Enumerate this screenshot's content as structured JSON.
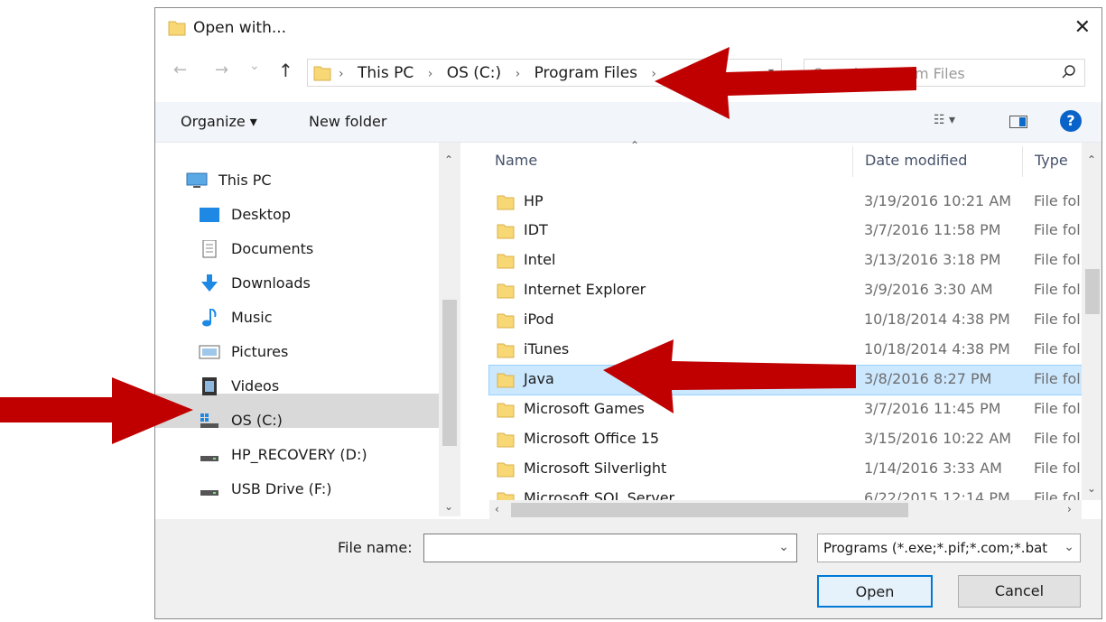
{
  "window": {
    "title": "Open with..."
  },
  "nav": {
    "back": "←",
    "forward": "→",
    "recent": "⌄",
    "up": "↑"
  },
  "address": {
    "crumbs": [
      "This PC",
      "OS (C:)",
      "Program Files"
    ],
    "separator": "›"
  },
  "search": {
    "placeholder": "Search Program Files"
  },
  "toolbar": {
    "organize": "Organize ▾",
    "new_folder": "New folder",
    "view": "☷ ▾",
    "help": "?"
  },
  "sidebar": {
    "items": [
      {
        "label": "This PC",
        "icon": "computer-icon"
      },
      {
        "label": "Desktop",
        "icon": "desktop-icon"
      },
      {
        "label": "Documents",
        "icon": "documents-icon"
      },
      {
        "label": "Downloads",
        "icon": "downloads-icon"
      },
      {
        "label": "Music",
        "icon": "music-icon"
      },
      {
        "label": "Pictures",
        "icon": "pictures-icon"
      },
      {
        "label": "Videos",
        "icon": "videos-icon"
      },
      {
        "label": "OS (C:)",
        "icon": "os-drive-icon"
      },
      {
        "label": "HP_RECOVERY (D:)",
        "icon": "drive-icon"
      },
      {
        "label": "USB Drive (F:)",
        "icon": "usb-drive-icon"
      }
    ],
    "selected": "OS (C:)"
  },
  "files": {
    "columns": {
      "name": "Name",
      "date": "Date modified",
      "type": "Type"
    },
    "rows": [
      {
        "name": "HP",
        "date": "3/19/2016 10:21 AM",
        "type": "File fol"
      },
      {
        "name": "IDT",
        "date": "3/7/2016 11:58 PM",
        "type": "File fol"
      },
      {
        "name": "Intel",
        "date": "3/13/2016 3:18 PM",
        "type": "File fol"
      },
      {
        "name": "Internet Explorer",
        "date": "3/9/2016 3:30 AM",
        "type": "File fol"
      },
      {
        "name": "iPod",
        "date": "10/18/2014 4:38 PM",
        "type": "File fol"
      },
      {
        "name": "iTunes",
        "date": "10/18/2014 4:38 PM",
        "type": "File fol"
      },
      {
        "name": "Java",
        "date": "3/8/2016 8:27 PM",
        "type": "File fol"
      },
      {
        "name": "Microsoft Games",
        "date": "3/7/2016 11:45 PM",
        "type": "File fol"
      },
      {
        "name": "Microsoft Office 15",
        "date": "3/15/2016 10:22 AM",
        "type": "File fol"
      },
      {
        "name": "Microsoft Silverlight",
        "date": "1/14/2016 3:33 AM",
        "type": "File fol"
      },
      {
        "name": "Microsoft SQL Server",
        "date": "6/22/2015 12:14 PM",
        "type": "File fol"
      }
    ],
    "selected": "Java"
  },
  "footer": {
    "file_name_label": "File name:",
    "file_name_value": "",
    "filter": "Programs (*.exe;*.pif;*.com;*.bat",
    "open": "Open",
    "cancel": "Cancel"
  },
  "colors": {
    "annotation_arrow": "#c00000",
    "selection": "#cce8ff",
    "folder": "#f8d775",
    "accent": "#0078d7"
  }
}
